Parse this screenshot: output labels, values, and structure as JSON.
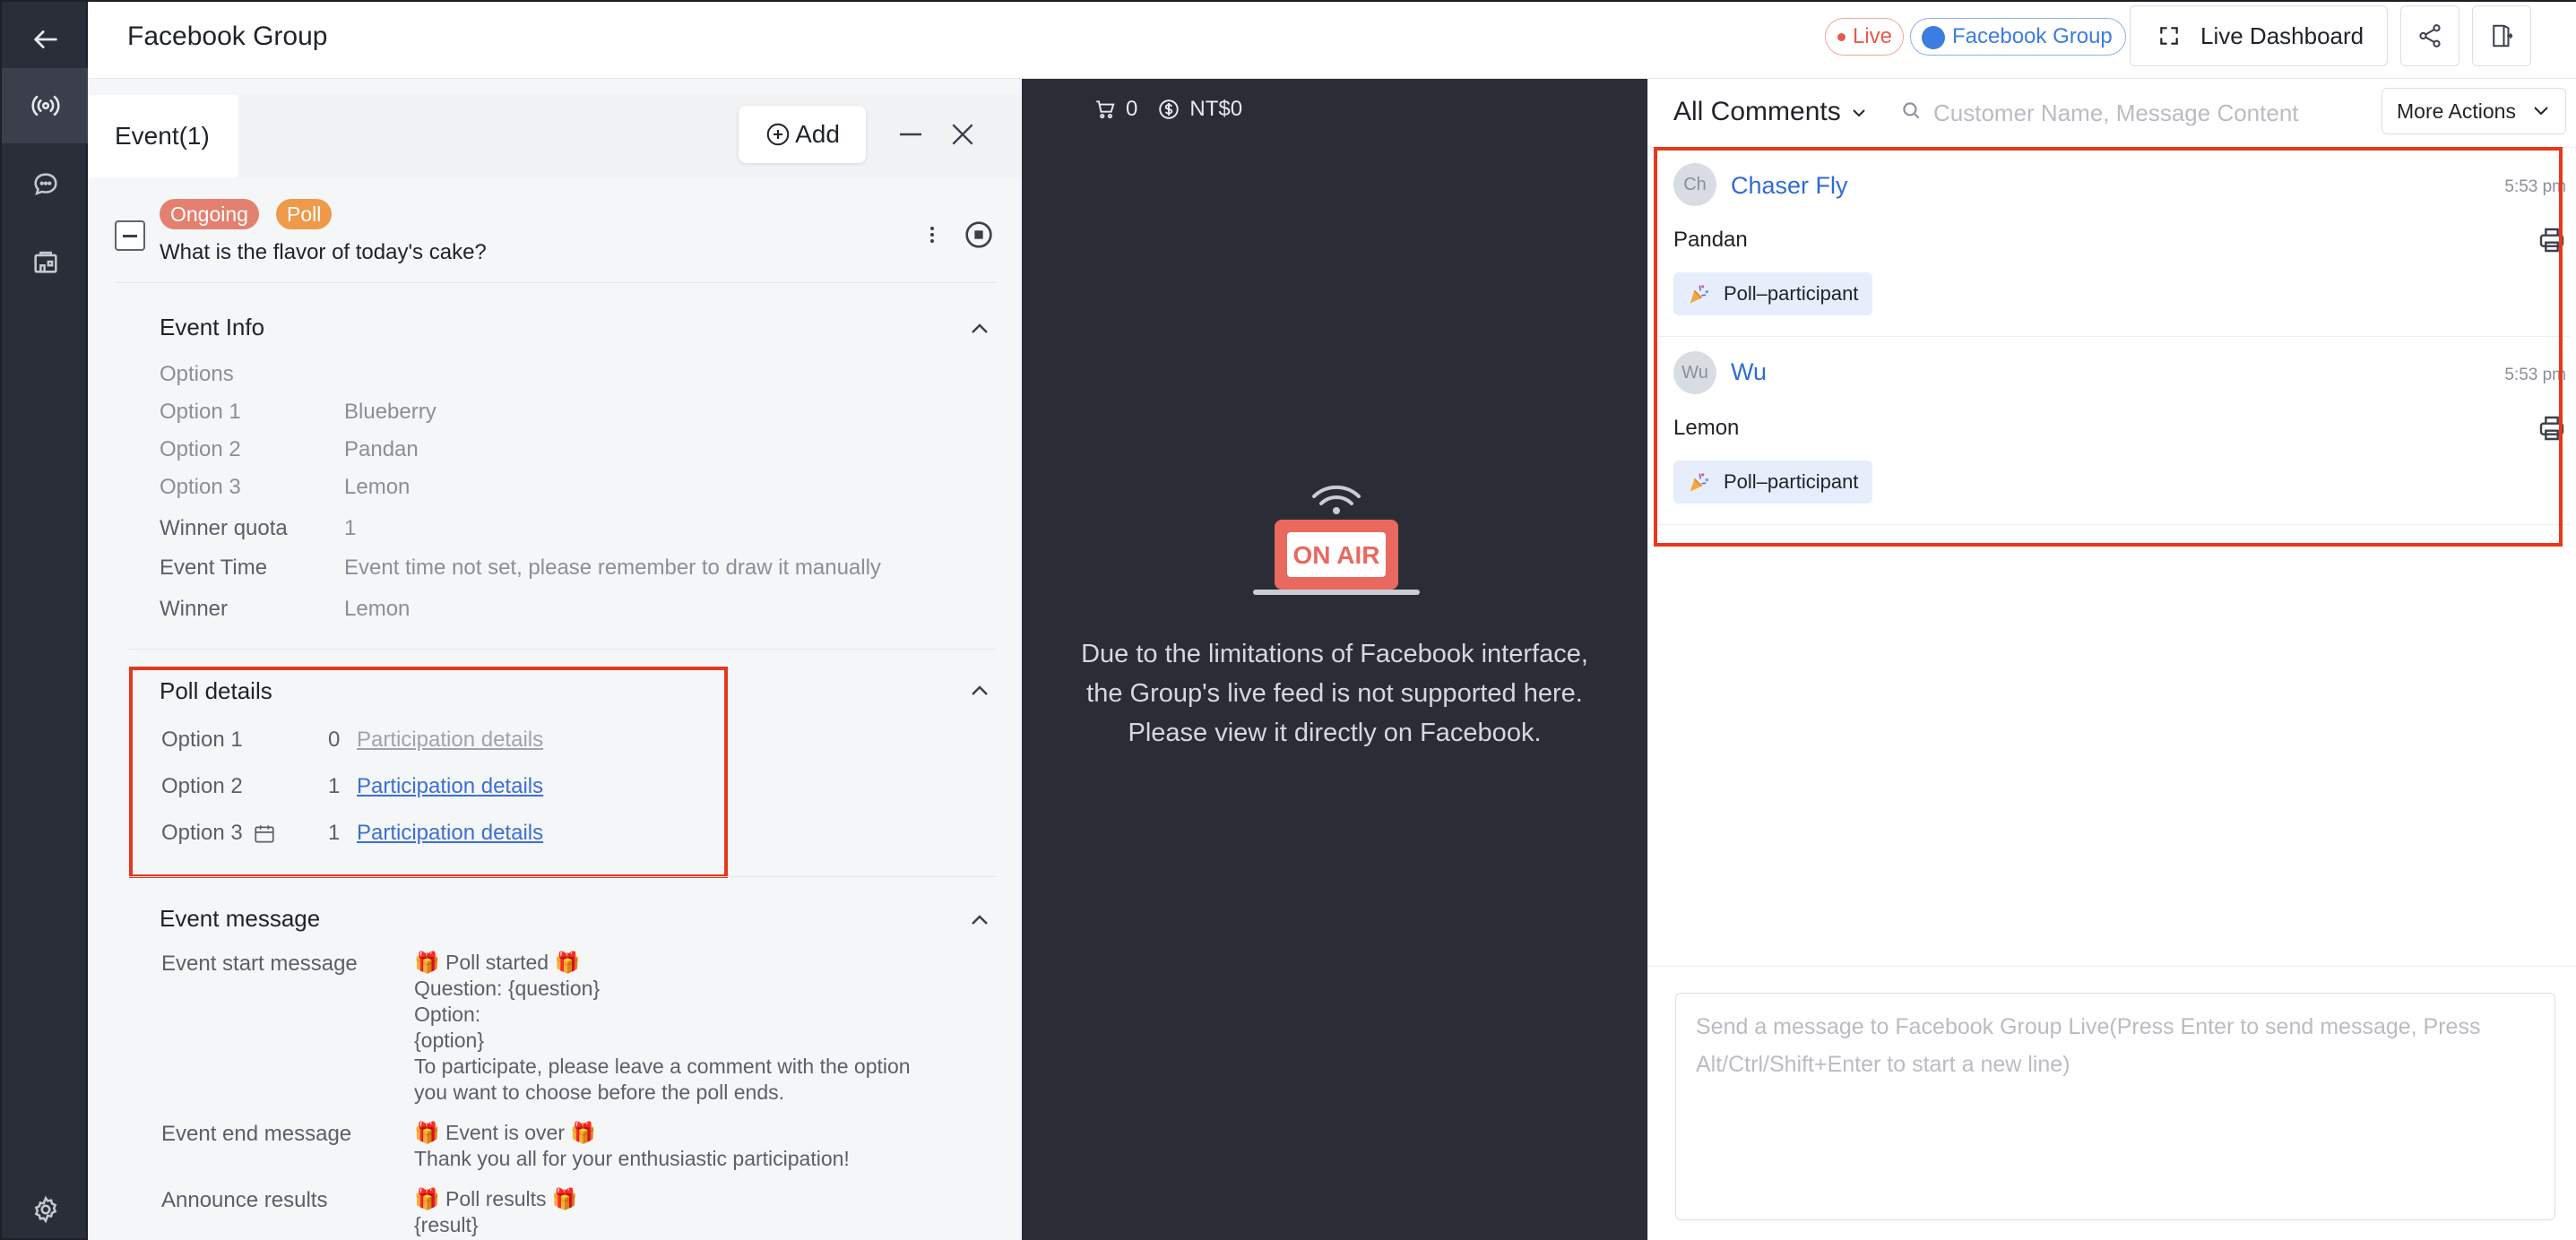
{
  "header": {
    "title": "Facebook Group",
    "live_badge": "Live",
    "platform_badge": "Facebook Group",
    "dashboard_label": "Live Dashboard"
  },
  "event_panel": {
    "tab_label": "Event(1)",
    "add_label": "Add",
    "event": {
      "status": "Ongoing",
      "type": "Poll",
      "question": "What is the flavor of today's cake?"
    },
    "event_info": {
      "title": "Event Info",
      "options_label": "Options",
      "options": [
        {
          "label": "Option 1",
          "value": "Blueberry"
        },
        {
          "label": "Option 2",
          "value": "Pandan"
        },
        {
          "label": "Option 3",
          "value": "Lemon"
        }
      ],
      "winner_quota_label": "Winner quota",
      "winner_quota": "1",
      "event_time_label": "Event Time",
      "event_time": "Event time not set, please remember to draw it manually",
      "winner_label": "Winner",
      "winner": "Lemon"
    },
    "poll_details": {
      "title": "Poll details",
      "rows": [
        {
          "label": "Option 1",
          "count": "0",
          "link": "Participation details",
          "enabled": false
        },
        {
          "label": "Option 2",
          "count": "1",
          "link": "Participation details",
          "enabled": true
        },
        {
          "label": "Option 3",
          "count": "1",
          "link": "Participation details",
          "enabled": true
        }
      ]
    },
    "event_message": {
      "title": "Event message",
      "start_label": "Event start message",
      "start_lines": [
        "🎁 Poll started 🎁",
        "Question: {question}",
        "Option:",
        "{option}",
        "To participate, please leave a comment with the option",
        "you want to choose before the poll ends."
      ],
      "end_label": "Event end message",
      "end_lines": [
        "🎁 Event is over 🎁",
        "Thank you all for your enthusiastic participation!"
      ],
      "results_label": "Announce results",
      "results_lines": [
        "🎁 Poll results 🎁",
        "{result}"
      ]
    }
  },
  "live_area": {
    "cart_count": "0",
    "amount": "NT$0",
    "onair_text": "ON AIR",
    "note": "Due to the limitations of Facebook interface, the Group's live feed is not supported here. Please view it directly on Facebook."
  },
  "comments": {
    "filter_label": "All Comments",
    "search_placeholder": "Customer Name, Message Content",
    "more_actions": "More Actions",
    "items": [
      {
        "initials": "Ch",
        "name": "Chaser Fly",
        "time": "5:53 pm",
        "text": "Pandan",
        "tag": "Poll–participant"
      },
      {
        "initials": "Wu",
        "name": "Wu",
        "time": "5:53 pm",
        "text": "Lemon",
        "tag": "Poll–participant"
      }
    ],
    "compose_placeholder": "Send a message to Facebook Group Live(Press Enter to send message, Press Alt/Ctrl/Shift+Enter to start a new line)"
  },
  "colors": {
    "rail_bg": "#2a2e38",
    "live_bg": "#2a2d36",
    "accent_blue": "#2f6bd6",
    "highlight_red": "#e5381c",
    "ongoing": "#e4806f",
    "poll": "#ee9a4a"
  },
  "icons": [
    "back-arrow-icon",
    "broadcast-icon",
    "chat-icon",
    "store-icon",
    "settings-icon",
    "expand-icon",
    "share-icon",
    "exit-icon",
    "plus-circle-icon",
    "minimize-icon",
    "close-icon",
    "kebab-icon",
    "stop-circle-icon",
    "chevron-up-icon",
    "calendar-icon",
    "cart-icon",
    "dollar-icon",
    "onair-icon",
    "search-icon",
    "chevron-down-icon",
    "printer-icon",
    "party-popper-icon"
  ]
}
